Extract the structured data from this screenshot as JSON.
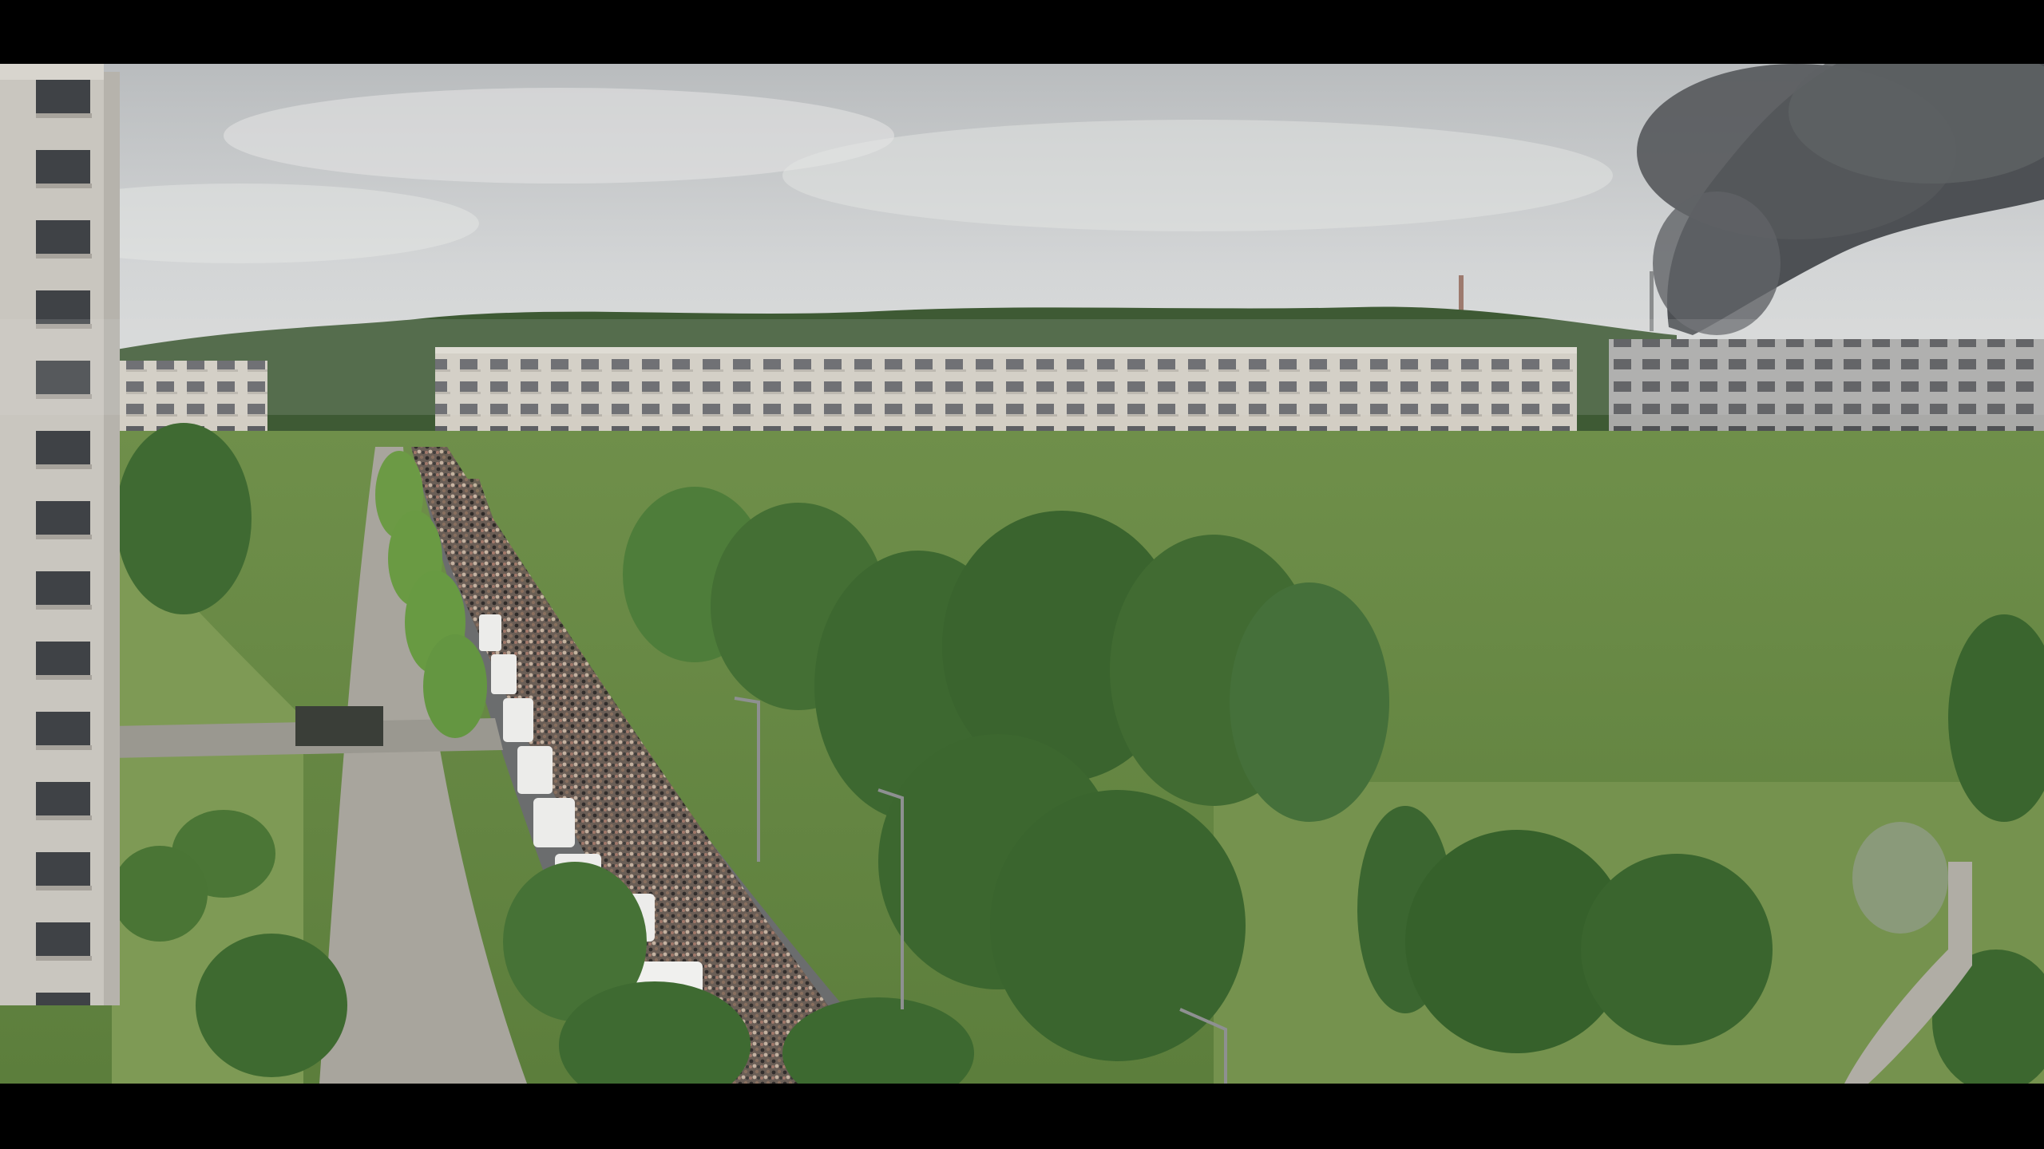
{
  "scene": {
    "description_visible_text": "",
    "sky_color": "#c9ccce",
    "smoke_color": "#4a4d50",
    "foliage_color": "#4f7d3a",
    "building_color": "#cfcac0",
    "road_color": "#6b6d6e",
    "letterbox_color": "#000000"
  }
}
